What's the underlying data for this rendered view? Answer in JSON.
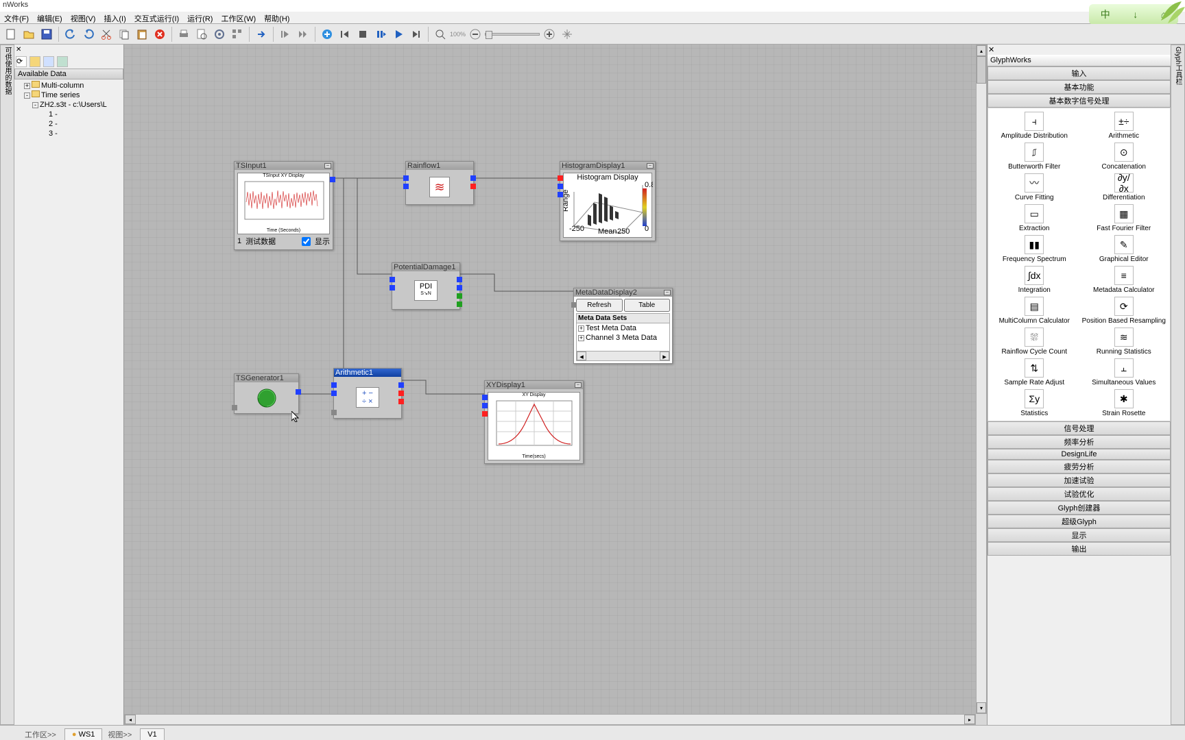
{
  "app_title": "nWorks",
  "menu": [
    "文件(F)",
    "编辑(E)",
    "视图(V)",
    "插入(I)",
    "交互式运行(I)",
    "运行(R)",
    "工作区(W)",
    "帮助(H)"
  ],
  "ime": [
    "中",
    "↓",
    "⌂"
  ],
  "zoom_label": "100%",
  "left": {
    "header": "Available Data",
    "tree": {
      "a": "Multi-column",
      "b": "Time series",
      "c": "ZH2.s3t - c:\\Users\\L",
      "r1": "1 -",
      "r2": "2 -",
      "r3": "3 -"
    },
    "vlabel": "可供使用的数据"
  },
  "nodes": {
    "tsinput": {
      "title": "TSInput1",
      "footer_num": "1",
      "footer_txt": "测试数据",
      "check": "显示",
      "chart_tit": "TSInput XY Display",
      "xaxis": "Time (Seconds)"
    },
    "rainflow": {
      "title": "Rainflow1"
    },
    "hist": {
      "title": "HistogramDisplay1",
      "chart_tit": "Histogram Display",
      "xl": "Mean",
      "yl": "Range"
    },
    "potdmg": {
      "title": "PotentialDamage1",
      "pdi": "PDI"
    },
    "tsgen": {
      "title": "TSGenerator1"
    },
    "arith": {
      "title": "Arithmetic1"
    },
    "xydisp": {
      "title": "XYDisplay1",
      "chart_tit": "XY Display",
      "xaxis": "Time(secs)"
    },
    "meta": {
      "title": "MetaDataDisplay2",
      "refresh": "Refresh",
      "table": "Table",
      "hdr": "Meta Data Sets",
      "r1": "Test Meta Data",
      "r2": "Channel 3 Meta Data"
    }
  },
  "right": {
    "title": "GlyphWorks",
    "sections_top": [
      "输入",
      "基本功能",
      "基本数字信号处理"
    ],
    "items": [
      {
        "l": "Amplitude Distribution",
        "g": "⫞"
      },
      {
        "l": "Arithmetic",
        "g": "±÷"
      },
      {
        "l": "Butterworth Filter",
        "g": "⎎"
      },
      {
        "l": "Concatenation",
        "g": "⊙"
      },
      {
        "l": "Curve Fitting",
        "g": "〰"
      },
      {
        "l": "Differentiation",
        "g": "∂y/∂x"
      },
      {
        "l": "Extraction",
        "g": "▭"
      },
      {
        "l": "Fast Fourier Filter",
        "g": "▦"
      },
      {
        "l": "Frequency Spectrum",
        "g": "▮▮"
      },
      {
        "l": "Graphical Editor",
        "g": "✎"
      },
      {
        "l": "Integration",
        "g": "∫dx"
      },
      {
        "l": "Metadata Calculator",
        "g": "≡"
      },
      {
        "l": "MultiColumn Calculator",
        "g": "▤"
      },
      {
        "l": "Position Based Resampling",
        "g": "⟳"
      },
      {
        "l": "Rainflow Cycle Count",
        "g": "⛆"
      },
      {
        "l": "Running Statistics",
        "g": "≋"
      },
      {
        "l": "Sample Rate Adjust",
        "g": "⇅"
      },
      {
        "l": "Simultaneous Values",
        "g": "⫠"
      },
      {
        "l": "Statistics",
        "g": "Σy"
      },
      {
        "l": "Strain Rosette",
        "g": "✱"
      }
    ],
    "sections_bot": [
      "信号处理",
      "频率分析",
      "DesignLife",
      "疲劳分析",
      "加速试验",
      "试验优化",
      "Glyph创建器",
      "超级Glyph",
      "显示",
      "输出"
    ],
    "vlabel": "Glyph工具栏"
  },
  "bottom": {
    "ws_lbl": "工作区>>",
    "ws1": "WS1",
    "v_lbl": "视图>>",
    "v1": "V1"
  },
  "chart_data": [
    {
      "type": "line",
      "title": "TSInput XY Display",
      "xlabel": "Time (Seconds)",
      "ylabel": "",
      "note": "noisy red time-series waveform, range approx ±1, preview only"
    },
    {
      "type": "heatmap",
      "title": "Histogram Display",
      "xlabel": "Mean",
      "ylabel": "Range",
      "xlim": [
        -250,
        250
      ],
      "ylim": [
        0,
        250
      ],
      "zlim": [
        0,
        0.8
      ],
      "note": "3D rainflow histogram preview"
    },
    {
      "type": "line",
      "title": "XY Display",
      "xlabel": "Time(secs)",
      "ylabel": "",
      "note": "red bell-curve shaped line preview"
    }
  ]
}
